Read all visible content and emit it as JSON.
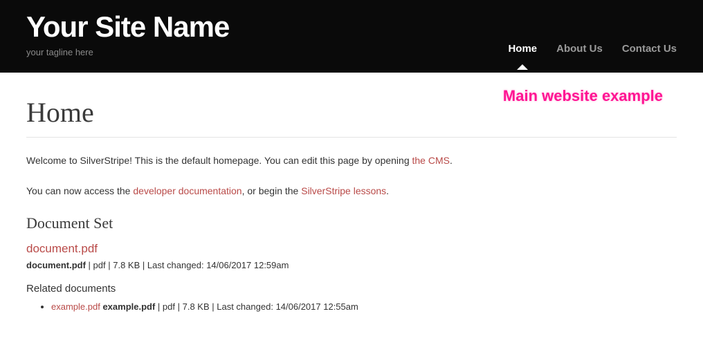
{
  "header": {
    "site_name": "Your Site Name",
    "tagline": "your tagline here",
    "nav": [
      {
        "label": "Home",
        "active": true
      },
      {
        "label": "About Us",
        "active": false
      },
      {
        "label": "Contact Us",
        "active": false
      }
    ]
  },
  "annotation": "Main website example",
  "page": {
    "title": "Home",
    "intro1_pre": "Welcome to SilverStripe! This is the default homepage. You can edit this page by opening ",
    "intro1_link": "the CMS",
    "intro1_post": ".",
    "intro2_pre": "You can now access the ",
    "intro2_link1": "developer documentation",
    "intro2_mid": ", or begin the ",
    "intro2_link2": "SilverStripe lessons",
    "intro2_post": "."
  },
  "docset": {
    "heading": "Document Set",
    "main": {
      "link": "document.pdf",
      "filename": "document.pdf",
      "ext": "pdf",
      "size": "7.8 KB",
      "last_changed_label": "Last changed:",
      "last_changed": "14/06/2017 12:59am"
    },
    "related_heading": "Related documents",
    "related": [
      {
        "link": "example.pdf",
        "filename": "example.pdf",
        "ext": "pdf",
        "size": "7.8 KB",
        "last_changed_label": "Last changed:",
        "last_changed": "14/06/2017 12:55am"
      }
    ]
  }
}
